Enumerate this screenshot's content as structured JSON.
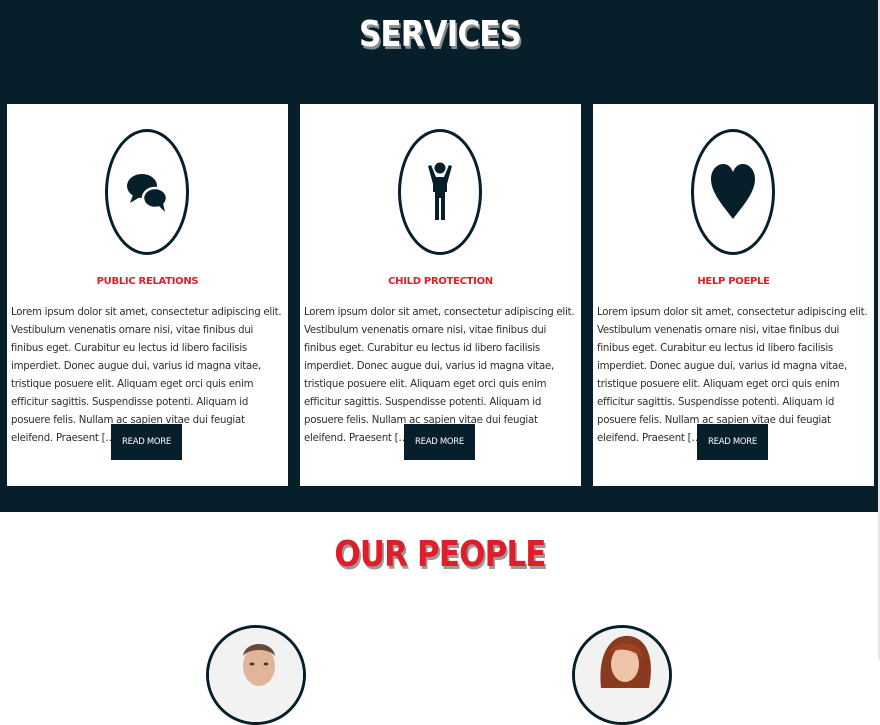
{
  "services": {
    "title": "SERVICES",
    "cards": [
      {
        "icon": "speech-bubbles-icon",
        "title": "PUBLIC RELATIONS",
        "text": "Lorem ipsum dolor sit amet, consectetur adipiscing elit. Vestibulum venenatis ornare nisi, vitae finibus dui finibus eget. Curabitur eu lectus id libero facilisis imperdiet. Donec augue dui, varius id magna vitae, tristique posuere elit. Aliquam eget orci quis enim efficitur sagittis. Suspendisse potenti. Aliquam id posuere felis. Nullam ac sapien vitae dui feugiat eleifend. Praesent […]",
        "button": "READ MORE"
      },
      {
        "icon": "child-icon",
        "title": "CHILD PROTECTION",
        "text": "Lorem ipsum dolor sit amet, consectetur adipiscing elit. Vestibulum venenatis ornare nisi, vitae finibus dui finibus eget. Curabitur eu lectus id libero facilisis imperdiet. Donec augue dui, varius id magna vitae, tristique posuere elit. Aliquam eget orci quis enim efficitur sagittis. Suspendisse potenti. Aliquam id posuere felis. Nullam ac sapien vitae dui feugiat eleifend. Praesent […]",
        "button": "READ MORE"
      },
      {
        "icon": "heart-icon",
        "title": "HELP POEPLE",
        "text": "Lorem ipsum dolor sit amet, consectetur adipiscing elit. Vestibulum venenatis ornare nisi, vitae finibus dui finibus eget. Curabitur eu lectus id libero facilisis imperdiet. Donec augue dui, varius id magna vitae, tristique posuere elit. Aliquam eget orci quis enim efficitur sagittis. Suspendisse potenti. Aliquam id posuere felis. Nullam ac sapien vitae dui feugiat eleifend. Praesent […]",
        "button": "READ MORE"
      }
    ]
  },
  "people": {
    "title": "OUR PEOPLE"
  },
  "colors": {
    "navy": "#071f2a",
    "accent_red": "#e01e2a",
    "card_bg": "#ffffff"
  }
}
